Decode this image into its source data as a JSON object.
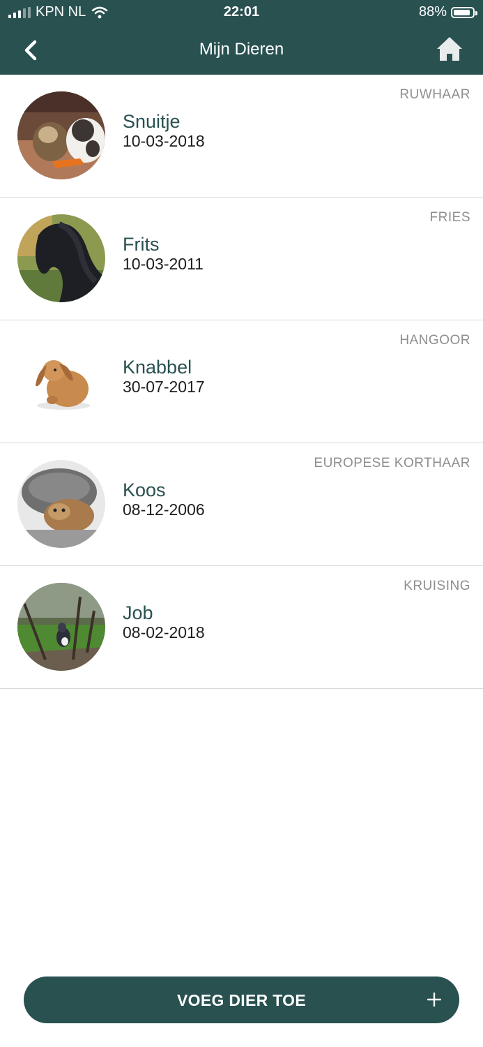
{
  "status_bar": {
    "carrier": "KPN NL",
    "time": "22:01",
    "battery": "88%",
    "battery_level": 0.88,
    "icons": [
      "signal-icon",
      "wifi-icon",
      "battery-icon"
    ]
  },
  "header": {
    "title": "Mijn Dieren",
    "back_icon": "chevron-left-icon",
    "home_icon": "home-icon"
  },
  "animals": [
    {
      "name": "Snuitje",
      "date": "10-03-2018",
      "breed": "RUWHAAR"
    },
    {
      "name": "Frits",
      "date": "10-03-2011",
      "breed": "FRIES"
    },
    {
      "name": "Knabbel",
      "date": "30-07-2017",
      "breed": "HANGOOR"
    },
    {
      "name": "Koos",
      "date": "08-12-2006",
      "breed": "EUROPESE KORTHAAR"
    },
    {
      "name": "Job",
      "date": "08-02-2018",
      "breed": "KRUISING"
    }
  ],
  "add_button": {
    "label": "VOEG DIER TOE",
    "icon": "plus-icon"
  },
  "colors": {
    "primary": "#285150",
    "breed_text": "#8e8e8e",
    "divider": "#d8d8d8"
  }
}
